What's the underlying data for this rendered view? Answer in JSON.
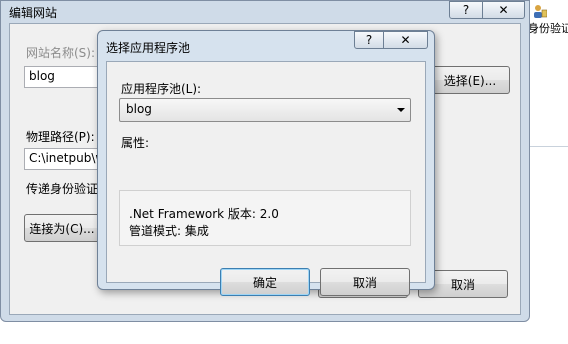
{
  "outer_dialog": {
    "title": "编辑网站",
    "help_btn": "?",
    "close_btn": "✕",
    "site_name_label": "网站名称(S):",
    "site_name_value": "blog",
    "select_btn": "选择(E)...",
    "physical_path_label": "物理路径(P):",
    "physical_path_value": "C:\\inetpub\\w",
    "pass_auth_label": "传递身份验证",
    "connect_as_btn": "连接为(C)...",
    "cancel_btn": "取消"
  },
  "background": {
    "right_label": "身份验证"
  },
  "inner_dialog": {
    "title": "选择应用程序池",
    "help_btn": "?",
    "close_btn": "✕",
    "app_pool_label": "应用程序池(L):",
    "app_pool_value": "blog",
    "properties_label": "属性:",
    "framework_line": ".Net Framework 版本: 2.0",
    "pipeline_line": "管道模式: 集成",
    "ok_btn": "确定",
    "cancel_btn": "取消"
  }
}
